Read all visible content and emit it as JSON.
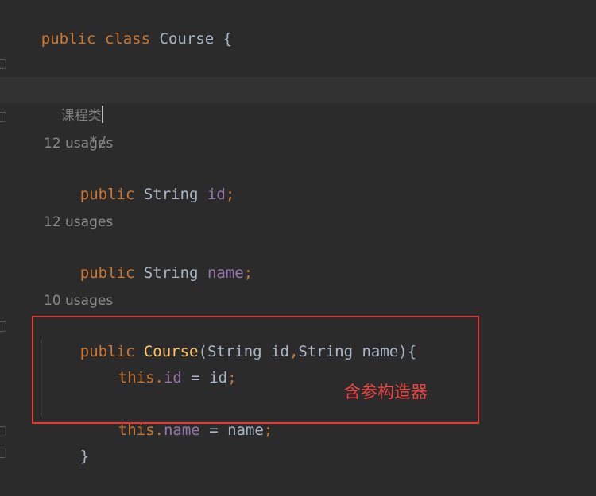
{
  "code": {
    "class_decl": {
      "kw_public": "public",
      "kw_class": "class",
      "name": "Course",
      "brace": "{"
    },
    "comment": {
      "open": "/*",
      "text": "课程类",
      "close": "*/"
    },
    "field_id": {
      "usages": "12 usages",
      "kw": "public",
      "type": "String",
      "name": "id",
      "semi": ";"
    },
    "field_name": {
      "usages": "12 usages",
      "kw": "public",
      "type": "String",
      "name": "name",
      "semi": ";"
    },
    "constructor": {
      "usages": "10 usages",
      "kw": "public",
      "name": "Course",
      "paren_open": "(",
      "p1_type": "String",
      "p1_name": "id",
      "comma": ",",
      "p2_type": "String",
      "p2_name": "name",
      "paren_close": "){",
      "stmt1": {
        "this": "this",
        "dot": ".",
        "field": "id",
        "eq": " = ",
        "value": "id",
        "semi": ";"
      },
      "stmt2": {
        "this": "this",
        "dot": ".",
        "field": "name",
        "eq": " = ",
        "value": "name",
        "semi": ";"
      },
      "close": "}"
    }
  },
  "annotation": {
    "label": "含参构造器",
    "color": "#e33a3a"
  }
}
